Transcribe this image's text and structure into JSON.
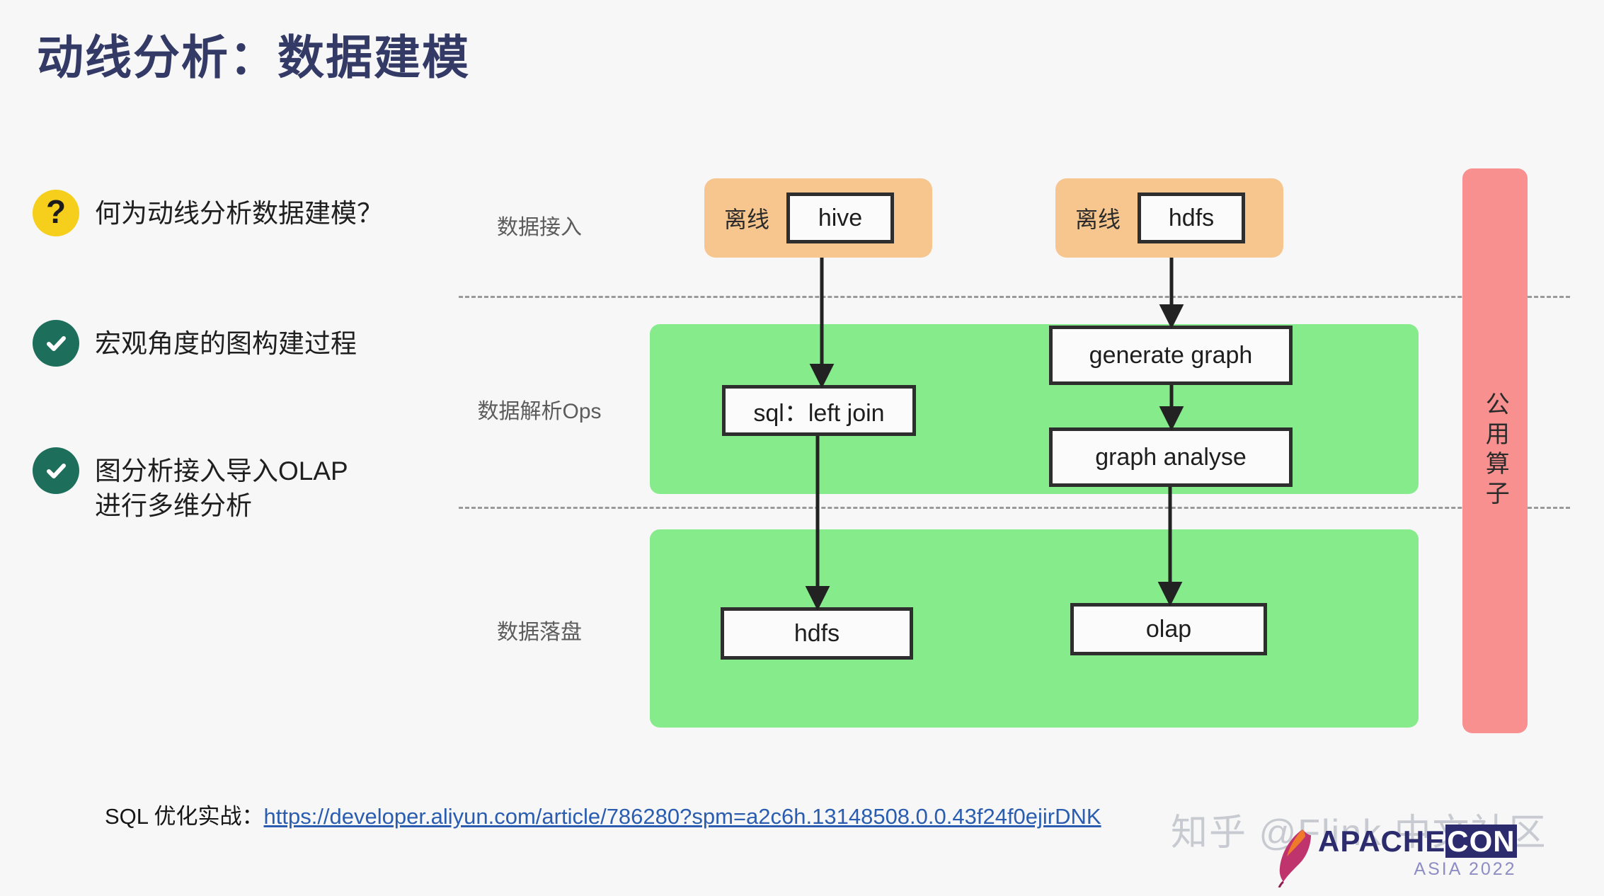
{
  "slide": {
    "title": "动线分析：数据建模",
    "background_color": "#f7f7f7",
    "title_color": "#333a66"
  },
  "bullets": [
    {
      "icon": "question-mark-icon",
      "icon_glyph": "?",
      "icon_color": "#f5cf1c",
      "text": "何为动线分析数据建模？"
    },
    {
      "icon": "check-circle-icon",
      "icon_glyph": "✓",
      "icon_color": "#1d6f5c",
      "text": "宏观角度的图构建过程"
    },
    {
      "icon": "check-circle-icon",
      "icon_glyph": "✓",
      "icon_color": "#1d6f5c",
      "text": "图分析接入导入OLAP\n进行多维分析"
    }
  ],
  "diagram": {
    "row_labels": [
      {
        "label": "数据接入"
      },
      {
        "label": "数据解析Ops"
      },
      {
        "label": "数据落盘"
      }
    ],
    "source_groups": [
      {
        "tag": "离线",
        "node": "hive"
      },
      {
        "tag": "离线",
        "node": "hdfs"
      }
    ],
    "process_nodes": [
      {
        "label": "sql：left join"
      },
      {
        "label": "generate graph"
      },
      {
        "label": "graph analyse"
      }
    ],
    "sink_nodes": [
      {
        "label": "hdfs"
      },
      {
        "label": "olap"
      }
    ],
    "side_bar": {
      "label": "公用算子",
      "color": "#f8908f"
    },
    "band_color": "#85eb8b",
    "source_band_color": "#f7c58e"
  },
  "footer": {
    "prefix": "SQL 优化实战：",
    "link": "https://developer.aliyun.com/article/786280?spm=a2c6h.13148508.0.0.43f24f0ejirDNK"
  },
  "branding": {
    "watermark": "知乎 @Flink 中文社区",
    "logo_title_main": "APACHE",
    "logo_title_con": "CON",
    "logo_subtitle": "ASIA 2022"
  }
}
